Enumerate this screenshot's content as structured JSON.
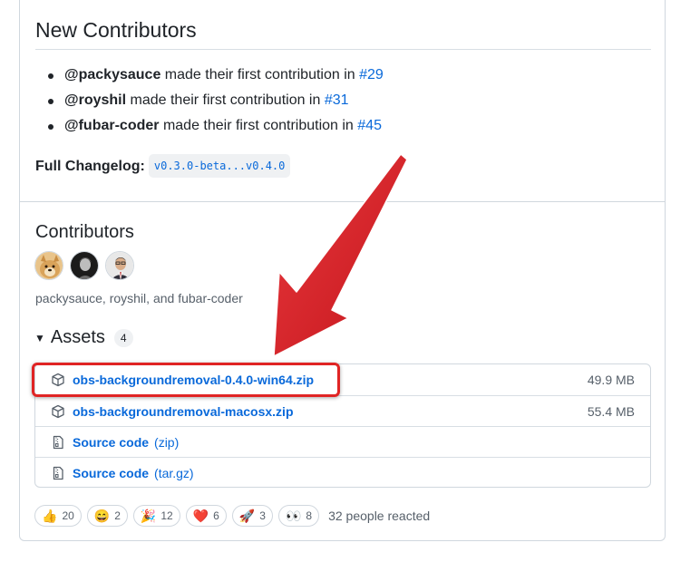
{
  "new_contributors": {
    "title": "New Contributors",
    "items": [
      {
        "user": "@packysauce",
        "text": " made their first contribution in ",
        "pr": "#29"
      },
      {
        "user": "@royshil",
        "text": " made their first contribution in ",
        "pr": "#31"
      },
      {
        "user": "@fubar-coder",
        "text": " made their first contribution in ",
        "pr": "#45"
      }
    ],
    "changelog_label": "Full Changelog:",
    "changelog_link": "v0.3.0-beta...v0.4.0"
  },
  "contributors": {
    "title": "Contributors",
    "names": "packysauce, royshil, and fubar-coder"
  },
  "assets": {
    "title": "Assets",
    "count": "4",
    "rows": [
      {
        "name": "obs-backgroundremoval-0.4.0-win64.zip",
        "ext": "",
        "size": "49.9 MB",
        "icon": "package-icon"
      },
      {
        "name": "obs-backgroundremoval-macosx.zip",
        "ext": "",
        "size": "55.4 MB",
        "icon": "package-icon"
      },
      {
        "name": "Source code",
        "ext": "(zip)",
        "size": "",
        "icon": "file-zip-icon"
      },
      {
        "name": "Source code",
        "ext": "(tar.gz)",
        "size": "",
        "icon": "file-zip-icon"
      }
    ]
  },
  "reactions": {
    "items": [
      {
        "emoji": "👍",
        "count": "20",
        "icon": "thumbs-up-icon"
      },
      {
        "emoji": "😄",
        "count": "2",
        "icon": "laugh-icon"
      },
      {
        "emoji": "🎉",
        "count": "12",
        "icon": "tada-icon"
      },
      {
        "emoji": "❤️",
        "count": "6",
        "icon": "heart-icon"
      },
      {
        "emoji": "🚀",
        "count": "3",
        "icon": "rocket-icon"
      },
      {
        "emoji": "👀",
        "count": "8",
        "icon": "eyes-icon"
      }
    ],
    "summary": "32 people reacted"
  },
  "colors": {
    "link": "#0969da",
    "annotation_red": "#e02424"
  }
}
